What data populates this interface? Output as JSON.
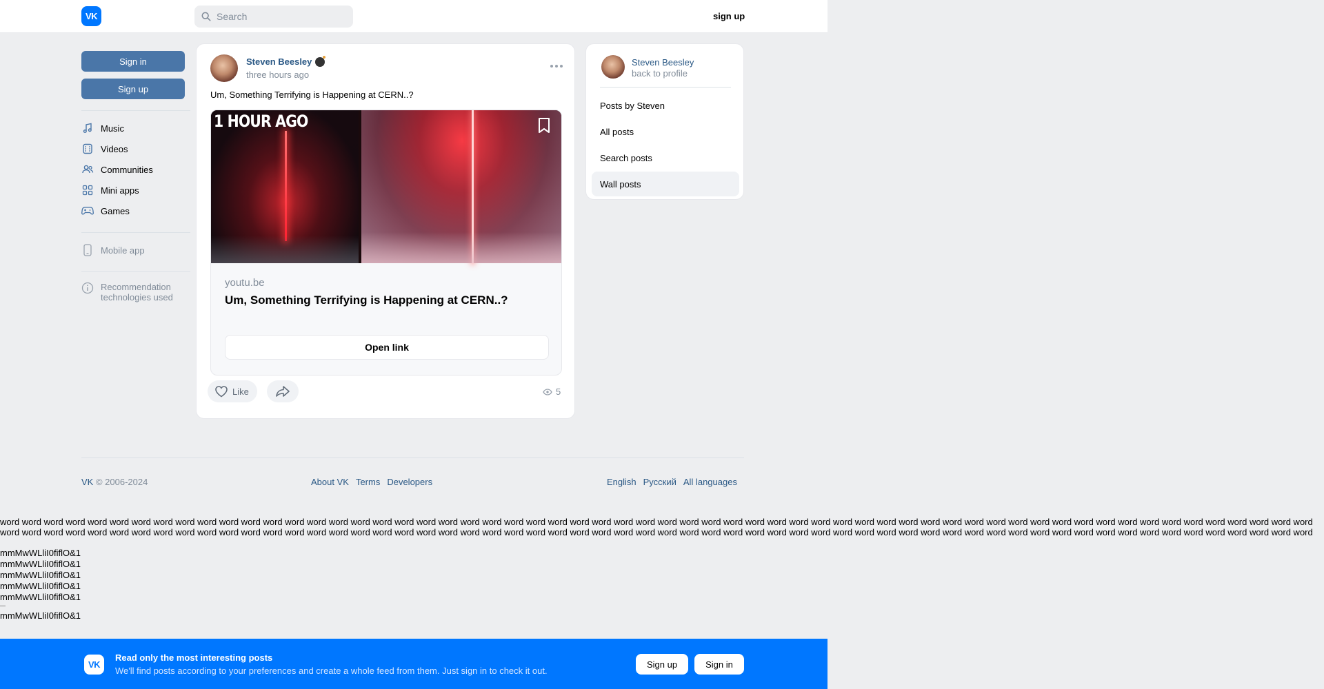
{
  "header": {
    "logo_text": "VK",
    "search_placeholder": "Search",
    "signup_label": "sign up"
  },
  "left_nav": {
    "sign_in_label": "Sign in",
    "sign_up_label": "Sign up",
    "items": [
      {
        "label": "Music",
        "icon": "music-note-icon"
      },
      {
        "label": "Videos",
        "icon": "video-icon"
      },
      {
        "label": "Communities",
        "icon": "people-icon"
      },
      {
        "label": "Mini apps",
        "icon": "grid-icon"
      },
      {
        "label": "Games",
        "icon": "gamepad-icon"
      }
    ],
    "mobile_app_label": "Mobile app",
    "recommendation_label": "Recommendation technologies used"
  },
  "post": {
    "author": "Steven Beesley",
    "time": "three hours ago",
    "text": "Um, Something Terrifying is Happening at CERN..?",
    "thumbnail_caption": "1 HOUR AGO",
    "link_domain": "youtu.be",
    "link_title": "Um, Something Terrifying is Happening at CERN..?",
    "open_link_label": "Open link",
    "like_label": "Like",
    "views": "5"
  },
  "right_panel": {
    "name": "Steven Beesley",
    "back_label": "back to profile",
    "items": [
      {
        "label": "Posts by Steven",
        "active": false
      },
      {
        "label": "All posts",
        "active": false
      },
      {
        "label": "Search posts",
        "active": false
      },
      {
        "label": "Wall posts",
        "active": true
      }
    ]
  },
  "footer": {
    "brand": "VK",
    "copyright": "© 2006-2024",
    "links": [
      "About VK",
      "Terms",
      "Developers"
    ],
    "languages": [
      "English",
      "Русский",
      "All languages"
    ]
  },
  "test_text": {
    "word": "word",
    "glyph_line": "mmMwWLliI0fiflO&1"
  },
  "promo": {
    "logo_text": "VK",
    "title": "Read only the most interesting posts",
    "subtitle": "We'll find posts according to your preferences and create a whole feed from them. Just sign in to check it out.",
    "signup_label": "Sign up",
    "signin_label": "Sign in"
  },
  "colors": {
    "brand_blue": "#0077ff",
    "link_blue": "#2a5885",
    "button_blue": "#4a76a8",
    "page_bg": "#edeef0"
  }
}
